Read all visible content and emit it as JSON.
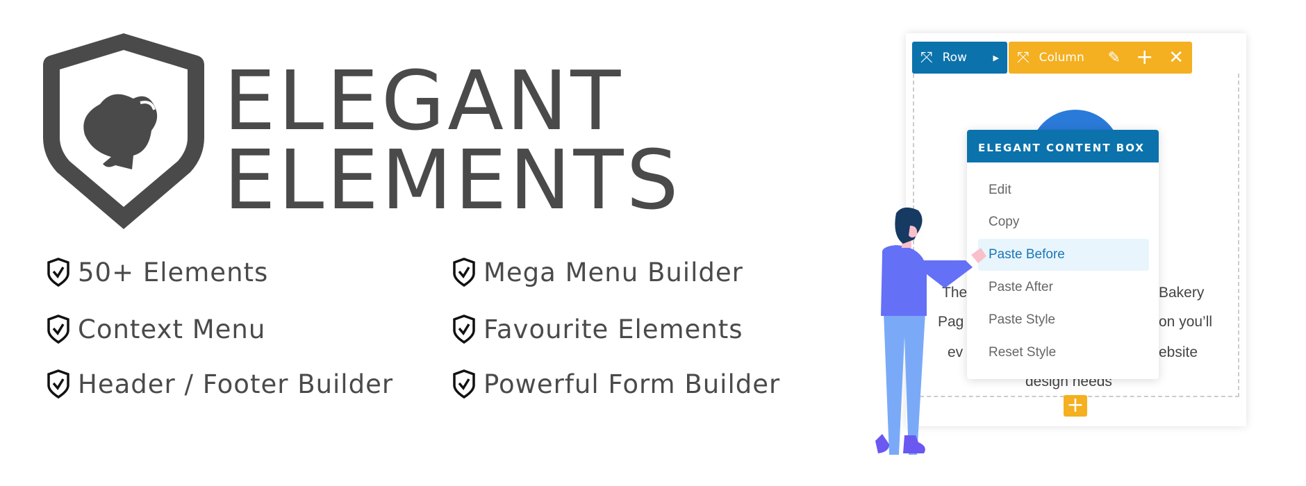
{
  "brand": {
    "line1": "ELEGANT",
    "line2": "ELEMENTS",
    "color": "#4a4a4a"
  },
  "features": [
    {
      "label": "50+ Elements",
      "icon": "shield-check-icon"
    },
    {
      "label": "Context Menu",
      "icon": "shield-check-icon"
    },
    {
      "label": "Header / Footer Builder",
      "icon": "shield-check-icon"
    },
    {
      "label": "Mega Menu Builder",
      "icon": "shield-check-icon"
    },
    {
      "label": "Favourite Elements",
      "icon": "shield-check-icon"
    },
    {
      "label": "Powerful Form Builder",
      "icon": "shield-check-icon"
    }
  ],
  "builder": {
    "row_label": "Row",
    "column_label": "Column",
    "colors": {
      "row": "#0b72ac",
      "column": "#f4b020"
    },
    "bg_text": {
      "l1a": "The",
      "l1b": "Bakery",
      "l2a": "Pag",
      "l2b": "on you’ll",
      "l3a": "ev",
      "l3b": "ebsite",
      "l4": "design needs"
    },
    "context_menu": {
      "title": "ELEGANT CONTENT BOX",
      "items": [
        "Edit",
        "Copy",
        "Paste Before",
        "Paste After",
        "Paste Style",
        "Reset Style"
      ],
      "active": "Paste Before"
    }
  }
}
